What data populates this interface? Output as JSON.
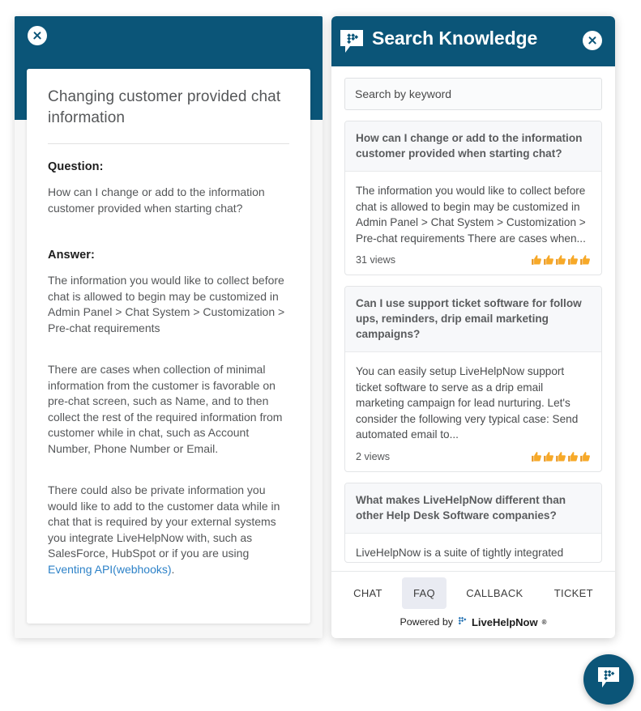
{
  "colors": {
    "header_blue": "#0b5578",
    "link_blue": "#2d82c8",
    "thumb_orange": "#f5a623",
    "panel_bg": "#f7f7f7",
    "active_tab_bg": "#e9ebf2"
  },
  "article": {
    "close_icon": "close-icon",
    "title": "Changing customer provided chat information",
    "question_label": "Question:",
    "question_text": "How can I change or add to the information customer provided when starting chat?",
    "answer_label": "Answer:",
    "answer_paragraphs": [
      "The information you would like to collect before chat is allowed to begin may be customized in Admin Panel > Chat System > Customization > Pre-chat requirements",
      "There are cases when collection of minimal information from the customer is favorable on pre-chat screen, such as Name, and to then collect the rest of the required information from customer while in chat, such as Account Number, Phone Number or Email."
    ],
    "final_paragraph_before_link": "There could also be private information you would like to add to the customer data while in chat that is required by your external systems you integrate LiveHelpNow with, such as SalesForce, HubSpot or if you are using ",
    "final_link_text": "Eventing API(webhooks)",
    "final_paragraph_after_link": "."
  },
  "knowledge": {
    "logo_icon": "livehelpnow-chat-logo-icon",
    "title": "Search Knowledge",
    "close_icon": "close-icon",
    "search": {
      "placeholder": "Search by keyword",
      "value": ""
    },
    "results": [
      {
        "title": "How can I change or add to the information customer provided when starting chat?",
        "snippet": "The information you would like to collect before chat is allowed to begin may be customized in Admin Panel > Chat System > Customization > Pre-chat requirements There are cases when...",
        "views": "31 views",
        "rating": 5
      },
      {
        "title": "Can I use support ticket software for follow ups, reminders, drip email marketing campaigns?",
        "snippet": "You can easily setup LiveHelpNow support ticket software to serve as a drip email marketing campaign for lead nurturing. Let's consider the following very typical case: Send automated email to...",
        "views": "2 views",
        "rating": 5
      },
      {
        "title": "What makes LiveHelpNow different than other Help Desk Software companies?",
        "snippet": "LiveHelpNow is a suite of tightly integrated",
        "views": "",
        "rating": 0
      }
    ],
    "tabs": [
      {
        "label": "CHAT",
        "active": false
      },
      {
        "label": "FAQ",
        "active": true
      },
      {
        "label": "CALLBACK",
        "active": false
      },
      {
        "label": "TICKET",
        "active": false
      }
    ],
    "footer": {
      "powered_by": "Powered by",
      "brand": "LiveHelpNow",
      "registered_mark": "®"
    }
  },
  "launcher": {
    "icon": "livehelpnow-chat-launcher-icon"
  }
}
